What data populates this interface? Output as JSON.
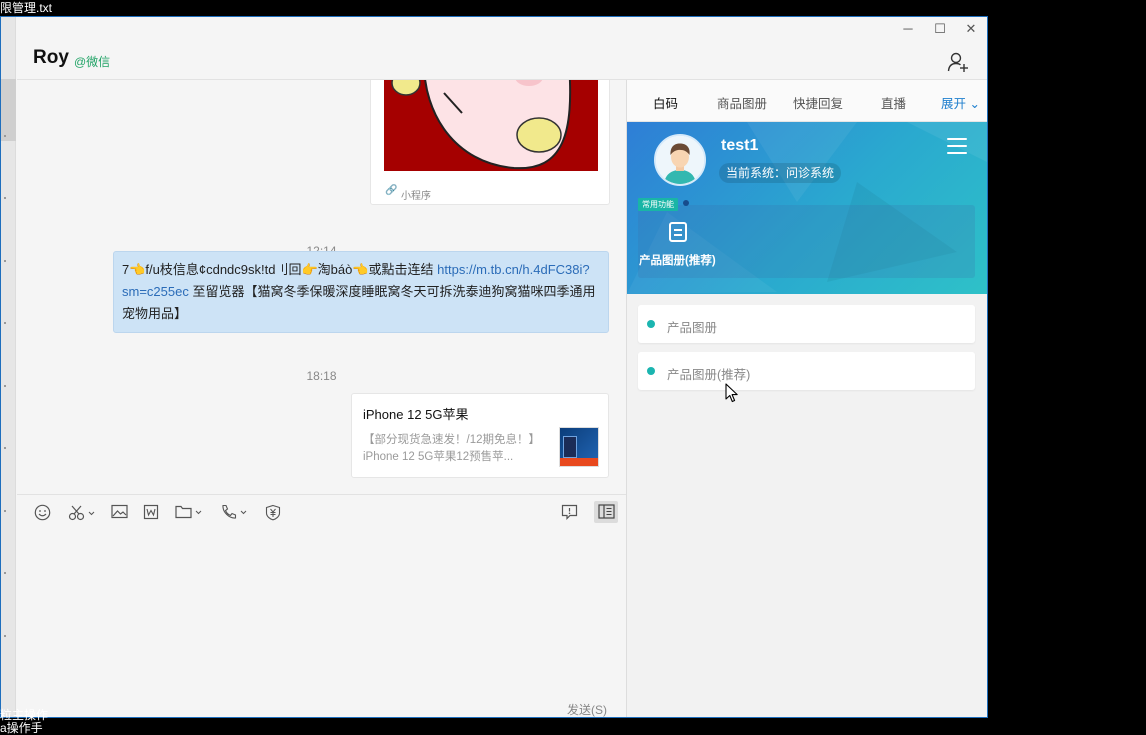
{
  "bg": {
    "title_fragment": "限管理.txt",
    "bottom_line1": "粒主操作",
    "bottom_line2": "a操作手"
  },
  "window": {
    "controls": {
      "minimize": "─",
      "maximize": "☐",
      "close": "✕"
    }
  },
  "header": {
    "contact_name": "Roy",
    "contact_tag": "@微信"
  },
  "chat": {
    "mini_program_label": "小程序",
    "time1": "12:14",
    "message_text_before_link": "7👈f/u枝信息¢cdndc9sk!td刂回👉淘báò👈或點击连结 ",
    "message_link": "https://m.tb.cn/h.4dFC38i?sm=c255ec",
    "message_text_after_link": " 至留览器【猫窝冬季保暖深度睡眠窝冬天可拆洗泰迪狗窝猫咪四季通用宠物用品】",
    "time2": "18:18",
    "product_title": "iPhone 12 5G苹果",
    "product_desc": "【部分现货急速发！/12期免息！】iPhone 12 5G苹果12预售苹..."
  },
  "toolbar": {
    "send_label": "发送(S)"
  },
  "panel": {
    "tabs": [
      {
        "label": "白码"
      },
      {
        "label": "商品图册"
      },
      {
        "label": "快捷回复"
      },
      {
        "label": "直播"
      },
      {
        "label": "展开 ⌄"
      }
    ],
    "user_name": "test1",
    "system_label": "当前系统：问诊系统",
    "func_tag": "常用功能",
    "func_label": "产品图册(推荐)",
    "items": [
      {
        "label": "产品图册"
      },
      {
        "label": "产品图册(推荐)"
      }
    ]
  },
  "colors": {
    "accent": "#1f7fce",
    "hero_start": "#2e7ed6",
    "hero_end": "#2ec1c8",
    "bubble": "#cde3f6",
    "dot": "#1bb5b0"
  }
}
